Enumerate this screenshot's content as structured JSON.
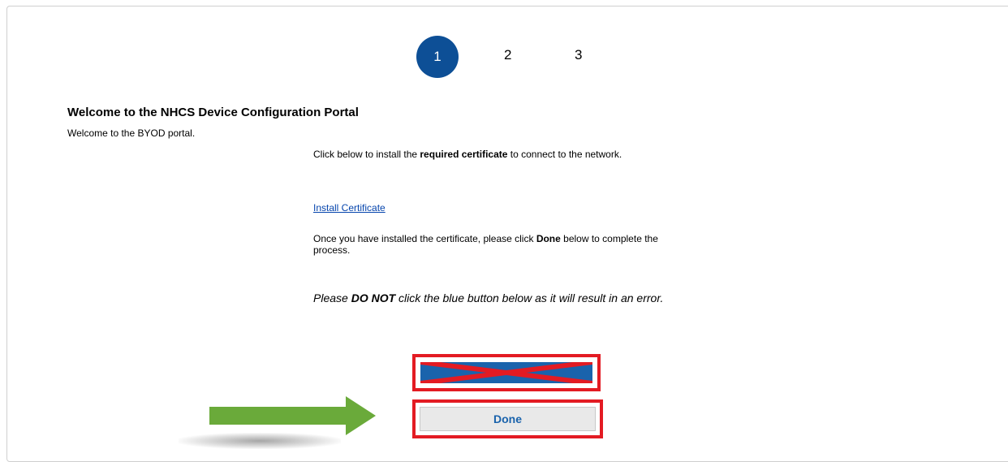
{
  "stepper": {
    "steps": [
      "1",
      "2",
      "3"
    ],
    "active_index": 0,
    "active_color": "#0d4f96"
  },
  "header": {
    "title": "Welcome to the NHCS Device Configuration Portal",
    "subtitle": "Welcome to the BYOD portal."
  },
  "instructions": {
    "p1_before": "Click below to install the ",
    "p1_bold": "required certificate",
    "p1_after": " to connect to the network.",
    "link_label": "Install Certificate",
    "p2_before": "Once you have installed the certificate, please click ",
    "p2_bold": "Done",
    "p2_after": " below to complete the process.",
    "p3_before": "Please ",
    "p3_bold": "DO NOT",
    "p3_after": " click the blue button below as it will result in an error."
  },
  "buttons": {
    "done_label": "Done"
  },
  "annotations": {
    "highlight_color": "#e31b23",
    "arrow_color": "#6aaa3a",
    "crossed_button_color": "#1a63ac"
  }
}
